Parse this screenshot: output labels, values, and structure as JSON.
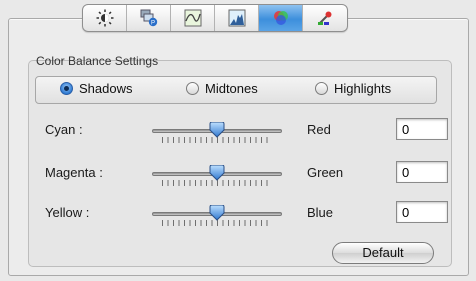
{
  "toolbar": {
    "tabs": [
      {
        "icon": "brightness-icon"
      },
      {
        "icon": "monitor-profile-icon"
      },
      {
        "icon": "curves-icon"
      },
      {
        "icon": "histogram-icon"
      },
      {
        "icon": "color-balance-icon",
        "active": true
      },
      {
        "icon": "color-picker-icon"
      }
    ]
  },
  "group": {
    "title": "Color Balance Settings",
    "tones": {
      "selected": "Shadows",
      "options": [
        "Shadows",
        "Midtones",
        "Highlights"
      ]
    }
  },
  "sliders": [
    {
      "left": "Cyan :",
      "right": "Red",
      "value": "0",
      "level": 0.5
    },
    {
      "left": "Magenta :",
      "right": "Green",
      "value": "0",
      "level": 0.5
    },
    {
      "left": "Yellow :",
      "right": "Blue",
      "value": "0",
      "level": 0.5
    }
  ],
  "default_button": "Default",
  "colors": {
    "accent": "#3d8fdc",
    "radio_on": "#2f7bd3"
  }
}
